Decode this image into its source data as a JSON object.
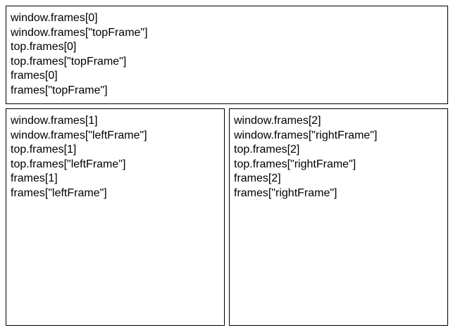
{
  "frames": {
    "top": {
      "lines": [
        "window.frames[0]",
        "window.frames[\"topFrame\"]",
        "top.frames[0]",
        "top.frames[\"topFrame\"]",
        "frames[0]",
        "frames[\"topFrame\"]"
      ]
    },
    "left": {
      "lines": [
        "window.frames[1]",
        "window.frames[\"leftFrame\"]",
        "top.frames[1]",
        "top.frames[\"leftFrame\"]",
        "frames[1]",
        "frames[\"leftFrame\"]"
      ]
    },
    "right": {
      "lines": [
        "window.frames[2]",
        "window.frames[\"rightFrame\"]",
        "top.frames[2]",
        "top.frames[\"rightFrame\"]",
        "frames[2]",
        "frames[\"rightFrame\"]"
      ]
    }
  },
  "colors": {
    "border": "#000000",
    "text": "#000000",
    "background": "#ffffff"
  }
}
